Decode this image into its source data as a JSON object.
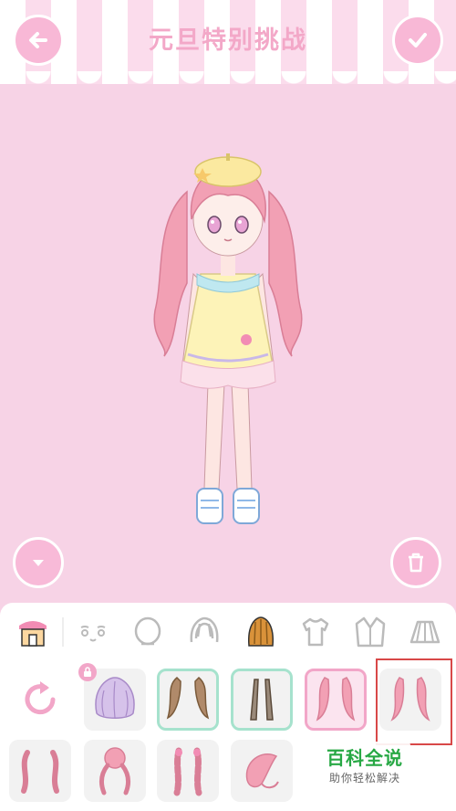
{
  "header": {
    "title": "元旦特别挑战"
  },
  "icons": {
    "back": "back-arrow-icon",
    "confirm": "checkmark-icon",
    "down": "chevron-down-icon",
    "trash": "trash-icon",
    "reset": "reset-icon",
    "lock": "lock-icon"
  },
  "tabs": [
    {
      "id": "shop",
      "icon": "shop-icon",
      "selected": false
    },
    {
      "id": "face",
      "icon": "face-icon",
      "selected": false
    },
    {
      "id": "head",
      "icon": "head-icon",
      "selected": false
    },
    {
      "id": "hair-front",
      "icon": "hair-front-icon",
      "selected": false
    },
    {
      "id": "hair-back",
      "icon": "hair-back-icon",
      "selected": true
    },
    {
      "id": "top",
      "icon": "shirt-icon",
      "selected": false
    },
    {
      "id": "jacket",
      "icon": "jacket-icon",
      "selected": false
    },
    {
      "id": "skirt",
      "icon": "skirt-icon",
      "selected": false
    }
  ],
  "watermark": {
    "title": "百科全说",
    "subtitle": "助你轻松解决"
  },
  "colors": {
    "background": "#f7d3e6",
    "accent": "#f8b8d6",
    "selected_border": "#f2a6c8",
    "owned_border": "#a6e2cd",
    "highlight": "#d84848",
    "watermark_green": "#27a844"
  }
}
